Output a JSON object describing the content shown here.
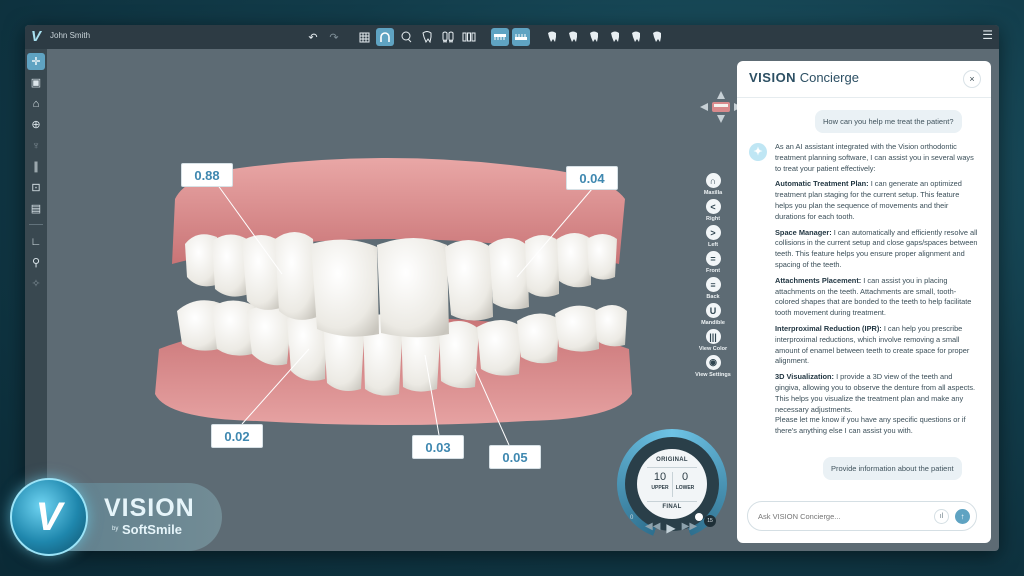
{
  "app": {
    "logo_letter": "V",
    "user_name": "John Smith",
    "menu_icon": "hamburger-icon"
  },
  "toolbar": {
    "undo_icon": "↶",
    "redo_icon": "↷",
    "view_tools": [
      "grid-icon",
      "arch-icon",
      "lasso-icon",
      "tooth-icon",
      "tooth-pair-icon",
      "teeth-icon"
    ],
    "jaw_toggles": [
      "upper-jaw-icon",
      "lower-jaw-icon"
    ],
    "tooth_tools": [
      "tooth-1-icon",
      "tooth-2-icon",
      "tooth-3-icon",
      "tooth-4-icon",
      "tooth-5-icon",
      "tooth-6-icon"
    ]
  },
  "sidebar": {
    "items": [
      {
        "icon": "move-icon",
        "glyph": "✛"
      },
      {
        "icon": "image-icon",
        "glyph": "▣"
      },
      {
        "icon": "tooth-house-icon",
        "glyph": "⌂"
      },
      {
        "icon": "axis-icon",
        "glyph": "⊕"
      },
      {
        "icon": "tooth-dim-icon",
        "glyph": "♆"
      },
      {
        "icon": "bars-icon",
        "glyph": "∥"
      },
      {
        "icon": "frame-icon",
        "glyph": "⊡"
      },
      {
        "icon": "ruler-icon",
        "glyph": "▤"
      },
      {
        "icon": "angle-icon",
        "glyph": "∟"
      },
      {
        "icon": "brush-icon",
        "glyph": "⚲"
      },
      {
        "icon": "compass-icon",
        "glyph": "✧"
      }
    ]
  },
  "measurements": [
    "0.88",
    "0.04",
    "0.02",
    "0.03",
    "0.05"
  ],
  "view_controls": [
    {
      "label": "Maxilla",
      "glyph": "∩"
    },
    {
      "label": "Right",
      "glyph": "<"
    },
    {
      "label": "Left",
      "glyph": ">"
    },
    {
      "label": "Front",
      "glyph": "="
    },
    {
      "label": "Back",
      "glyph": "≡"
    },
    {
      "label": "Mandible",
      "glyph": "U"
    },
    {
      "label": "View Color",
      "glyph": "|||"
    },
    {
      "label": "View Settings",
      "glyph": "◉"
    }
  ],
  "staging_dial": {
    "top_label": "ORIGINAL",
    "bottom_label": "FINAL",
    "upper_value": "10",
    "upper_label": "UPPER",
    "lower_value": "0",
    "lower_label": "LOWER",
    "start_stage": "0",
    "end_stage": "15",
    "progress": 1.0
  },
  "playback": {
    "prev": "◀◀",
    "play": "▶",
    "next": "▶▶"
  },
  "chat": {
    "title_brand": "VISION",
    "title_rest": "Concierge",
    "close_glyph": "×",
    "user_question": "How can you help me treat the patient?",
    "ai_intro": "As an AI assistant integrated with the Vision orthodontic treatment planning software, I can assist you in several ways to treat your patient effectively:",
    "features": [
      {
        "title": "Automatic Treatment Plan:",
        "text": " I can generate an optimized treatment plan staging for the current setup. This feature helps you plan the sequence of movements and their durations for each tooth."
      },
      {
        "title": "Space Manager:",
        "text": " I can automatically and efficiently resolve all collisions in the current setup and close gaps/spaces between teeth. This feature helps you ensure proper alignment and spacing of the teeth."
      },
      {
        "title": "Attachments Placement:",
        "text": " I can assist you in placing attachments on the teeth. Attachments are small, tooth-colored shapes that are bonded to the teeth to help facilitate tooth movement during treatment."
      },
      {
        "title": "Interproximal Reduction (IPR):",
        "text": " I can help you prescribe interproximal reductions, which involve removing a small amount of enamel between teeth to create space for proper alignment."
      },
      {
        "title": "3D Visualization:",
        "text": " I provide a 3D view of the teeth and gingiva, allowing you to observe the denture from all aspects. This helps you visualize the treatment plan and make any necessary adjustments."
      }
    ],
    "ai_outro": "Please let me know if you have any specific questions or if there's anything else I can assist you with.",
    "user_followup": "Provide information about the patient",
    "input_placeholder": "Ask VISION Concierge...",
    "mic_glyph": "ıl",
    "send_glyph": "↑"
  },
  "brand": {
    "letter": "V",
    "name": "VISION",
    "by": "by",
    "company": "SoftSmile"
  },
  "colors": {
    "accent": "#5fa3c2",
    "gum": "#d98a8c",
    "tooth": "#f1f1ee",
    "callout_text": "#3f88b0"
  }
}
